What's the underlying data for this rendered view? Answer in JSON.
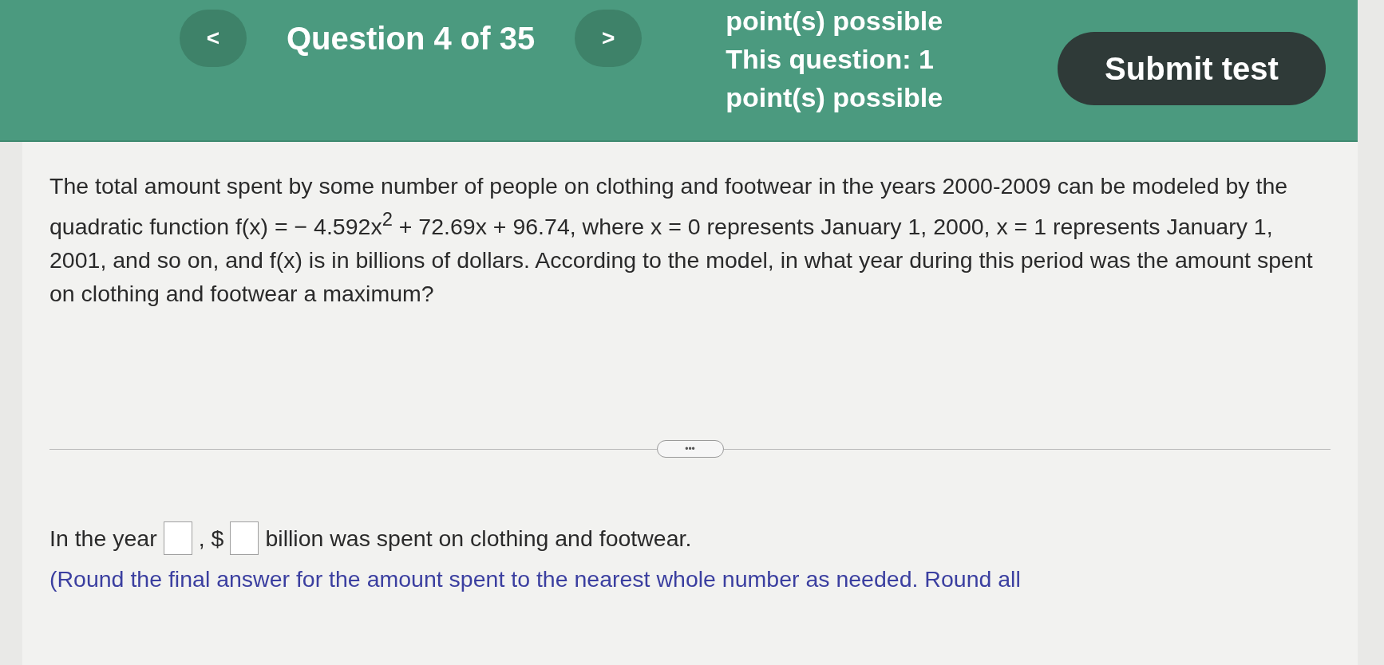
{
  "header": {
    "prev_button": "<",
    "question_label": "Question 4 of 35",
    "next_button": ">",
    "points_lines": [
      "point(s) possible",
      "This question: 1",
      "point(s) possible"
    ],
    "submit_button": "Submit test"
  },
  "question": {
    "text": "The total amount spent by some number of people on clothing and footwear in the years 2000-2009 can be modeled by the quadratic function f(x) = − 4.592x$^{2}$ + 72.69x + 96.74, where x = 0 represents January 1, 2000, x = 1 represents January 1, 2001, and so on, and f(x) is in billions of dollars. According to the model, in what year during this period was the amount spent on clothing and footwear a maximum?"
  },
  "expand_button": "•••",
  "answer": {
    "parts": [
      {
        "kind": "text",
        "text": "In the year"
      },
      {
        "kind": "field"
      },
      {
        "kind": "text",
        "text": ","
      },
      {
        "kind": "text",
        "text": "$"
      },
      {
        "kind": "field"
      },
      {
        "kind": "text",
        "text": "billion was spent on clothing and footwear."
      }
    ]
  },
  "note": "(Round the final answer for the amount spent to the nearest whole number as needed. Round all"
}
